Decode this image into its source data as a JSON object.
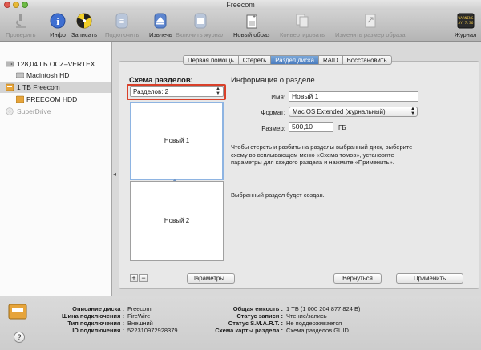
{
  "window": {
    "title": "Freecom"
  },
  "toolbar": {
    "items": [
      {
        "label": "Проверить",
        "icon": "microscope-icon",
        "enabled": false
      },
      {
        "label": "Инфо",
        "icon": "info-icon",
        "enabled": true
      },
      {
        "label": "Записать",
        "icon": "burn-icon",
        "enabled": true
      },
      {
        "label": "Подключить",
        "icon": "mount-icon",
        "enabled": false
      },
      {
        "label": "Извлечь",
        "icon": "eject-icon",
        "enabled": true
      },
      {
        "label": "Включить журнал",
        "icon": "journal-enable-icon",
        "enabled": false
      },
      {
        "label": "Новый образ",
        "icon": "new-image-icon",
        "enabled": true
      },
      {
        "label": "Конвертировать",
        "icon": "convert-icon",
        "enabled": false
      },
      {
        "label": "Изменить размер образа",
        "icon": "resize-image-icon",
        "enabled": false
      },
      {
        "label": "Журнал",
        "icon": "log-icon",
        "enabled": true
      }
    ],
    "log_icon_text": "WARNING\nAY 7:36"
  },
  "sidebar": {
    "items": [
      {
        "label": "128,04 ГБ OCZ–VERTEX…",
        "icon": "hard-drive-icon",
        "level": 0,
        "selected": false,
        "dim": false
      },
      {
        "label": "Macintosh HD",
        "icon": "volume-icon",
        "level": 1,
        "selected": false,
        "dim": false
      },
      {
        "label": "1 ТБ Freecom",
        "icon": "external-drive-icon",
        "level": 0,
        "selected": true,
        "dim": false
      },
      {
        "label": "FREECOM HDD",
        "icon": "volume-icon",
        "level": 1,
        "selected": false,
        "dim": false
      },
      {
        "label": "SuperDrive",
        "icon": "optical-drive-icon",
        "level": 0,
        "selected": false,
        "dim": true
      }
    ]
  },
  "tabs": [
    {
      "label": "Первая помощь",
      "active": false
    },
    {
      "label": "Стереть",
      "active": false
    },
    {
      "label": "Раздел диска",
      "active": true
    },
    {
      "label": "RAID",
      "active": false
    },
    {
      "label": "Восстановить",
      "active": false
    }
  ],
  "scheme": {
    "label": "Схема разделов:",
    "selected": "Разделов: 2",
    "partitions": [
      "Новый 1",
      "Новый 2"
    ]
  },
  "info": {
    "title": "Информация о разделе",
    "name_label": "Имя:",
    "name_value": "Новый 1",
    "format_label": "Формат:",
    "format_value": "Mac OS Extended (журнальный)",
    "size_label": "Размер:",
    "size_value": "500,10",
    "size_unit": "ГБ",
    "description": "Чтобы стереть и разбить на разделы выбранный диск, выберите схему во всплывающем меню «Схема томов», установите параметры для каждого раздела и нажмите «Применить».",
    "status": "Выбранный раздел будет создан."
  },
  "buttons": {
    "add": "+",
    "remove": "−",
    "options": "Параметры…",
    "revert": "Вернуться",
    "apply": "Применить"
  },
  "details": {
    "left": [
      {
        "label": "Описание диска :",
        "value": "Freecom"
      },
      {
        "label": "Шина подключения :",
        "value": "FireWire"
      },
      {
        "label": "Тип подключения :",
        "value": "Внешний"
      },
      {
        "label": "ID подключения :",
        "value": "522310972928379"
      }
    ],
    "right": [
      {
        "label": "Общая емкость :",
        "value": "1 ТБ (1 000 204 877 824 Б)"
      },
      {
        "label": "Статус записи :",
        "value": "Чтение/запись"
      },
      {
        "label": "Статус S.M.A.R.T. :",
        "value": "Не поддерживается"
      },
      {
        "label": "Схема карты раздела :",
        "value": "Схема разделов GUID"
      }
    ],
    "help": "?"
  }
}
